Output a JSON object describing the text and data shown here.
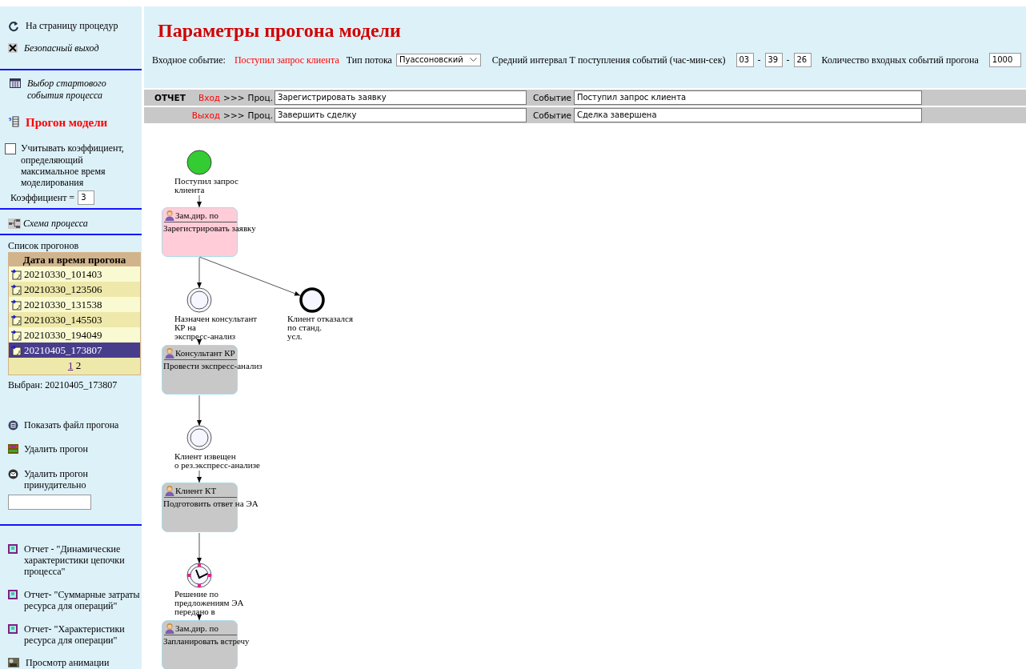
{
  "sidebar": {
    "nav": [
      {
        "label": "На страницу процедур",
        "kind": "plain"
      },
      {
        "label": "Безопасный выход",
        "kind": "italic"
      }
    ],
    "process": [
      {
        "label": "Выбор стартового события процесса",
        "kind": "italic"
      },
      {
        "label": "Прогон модели",
        "kind": "current"
      }
    ],
    "coefficient": {
      "checked": false,
      "label": "Учитывать коэффициент, определяющий максимальное время моделирования",
      "field_label": "Коэффициент =",
      "value": "3"
    },
    "scheme": {
      "label": "Схема процесса",
      "kind": "italic"
    },
    "runs": {
      "title": "Список прогонов",
      "header": "Дата и время прогона",
      "rows": [
        {
          "label": "20210330_101403",
          "selected": false
        },
        {
          "label": "20210330_123506",
          "selected": false
        },
        {
          "label": "20210330_131538",
          "selected": false
        },
        {
          "label": "20210330_145503",
          "selected": false
        },
        {
          "label": "20210330_194049",
          "selected": false
        },
        {
          "label": "20210405_173807",
          "selected": true
        }
      ],
      "pages": [
        {
          "label": "1",
          "selected": false
        },
        {
          "label": "2",
          "selected": true
        }
      ],
      "chosen": "Выбран: 20210405_173807"
    },
    "actions": [
      {
        "label": "Показать файл прогона"
      },
      {
        "label": "Удалить прогон"
      },
      {
        "label": "Удалить прогон принудительно"
      }
    ],
    "reports": [
      {
        "label": "Отчет - \"Динамические характеристики цепочки процесса\""
      },
      {
        "label": "Отчет- \"Суммарные затраты ресурса для операций\""
      },
      {
        "label": "Отчет- \"Характеристики ресурса для операции\""
      },
      {
        "label": "Просмотр анимации"
      }
    ]
  },
  "main": {
    "title": "Параметры прогона модели",
    "params": {
      "input_event_label": "Входное событие:",
      "input_event": "Поступил запрос клиента",
      "flow_type_label": "Тип потока",
      "flow_type": "Пуассоновский",
      "interval_label": "Средний интервал Т поступления событий (час-мин-сек)",
      "interval": [
        "03",
        "39",
        "26"
      ],
      "separator": "-",
      "count_label": "Количество входных событий прогона",
      "count": "1000"
    },
    "report": {
      "heading": "ОТЧЕТ",
      "rows": [
        {
          "direction": "Вход",
          "arrows": ">>>",
          "process_label": "Проц.",
          "process": "Зарегистрировать заявку",
          "event_label": "Событие",
          "event": "Поступил запрос клиента"
        },
        {
          "direction": "Выход",
          "arrows": ">>>",
          "process_label": "Проц.",
          "process": "Завершить сделку",
          "event_label": "Событие",
          "event": "Сделка завершена"
        }
      ]
    },
    "diagram": {
      "steps": [
        {
          "event": {
            "kind": "start",
            "label": "Поступил запрос\nклиента"
          },
          "task": {
            "role": "Зам.дир. по",
            "name": "Зарегистрировать заявку",
            "color": "#ffccd8"
          },
          "branches": [
            {
              "kind": "end",
              "label": "Клиент отказался\nпо станд.\nусл."
            }
          ]
        },
        {
          "event": {
            "kind": "intermediate",
            "label": "Назначен консультант\nКР на\nэкспресс-анализ"
          },
          "task": {
            "role": "Консультант КР",
            "name": "Провести экспресс-анализ",
            "color": "#c8c8c8"
          }
        },
        {
          "event": {
            "kind": "intermediate",
            "label": "Клиент извещен\nо рез.экспресс-анализе"
          },
          "task": {
            "role": "Клиент КТ",
            "name": "Подготовить ответ на ЭА",
            "color": "#c8c8c8"
          }
        },
        {
          "event": {
            "kind": "timer",
            "label": "Решение по\nпредложениям ЭА\nпередано в"
          },
          "task": {
            "role": "Зам.дир. по",
            "name": "Запланировать встречу",
            "color": "#c8c8c8"
          }
        }
      ]
    }
  }
}
